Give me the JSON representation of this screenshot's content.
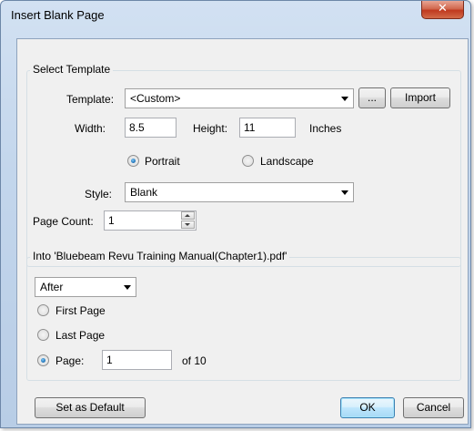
{
  "window": {
    "title": "Insert Blank Page",
    "close_glyph": "✕"
  },
  "select_template": {
    "group_label": "Select Template",
    "template_label": "Template:",
    "template_value": "<Custom>",
    "browse_label": "...",
    "import_label": "Import",
    "width_label": "Width:",
    "width_value": "8.5",
    "height_label": "Height:",
    "height_value": "11",
    "units_label": "Inches",
    "portrait_label": "Portrait",
    "landscape_label": "Landscape",
    "orientation_selected": "Portrait",
    "style_label": "Style:",
    "style_value": "Blank",
    "page_count_label": "Page Count:",
    "page_count_value": "1"
  },
  "into": {
    "group_label": "Into 'Bluebeam Revu Training Manual(Chapter1).pdf'",
    "position_value": "After",
    "first_page_label": "First Page",
    "last_page_label": "Last Page",
    "page_label": "Page:",
    "page_value": "1",
    "of_label": "of 10",
    "selected": "Page"
  },
  "footer": {
    "set_default_label": "Set as Default",
    "ok_label": "OK",
    "cancel_label": "Cancel"
  },
  "colors": {
    "accent": "#3c7fb1",
    "close": "#c0391f"
  }
}
